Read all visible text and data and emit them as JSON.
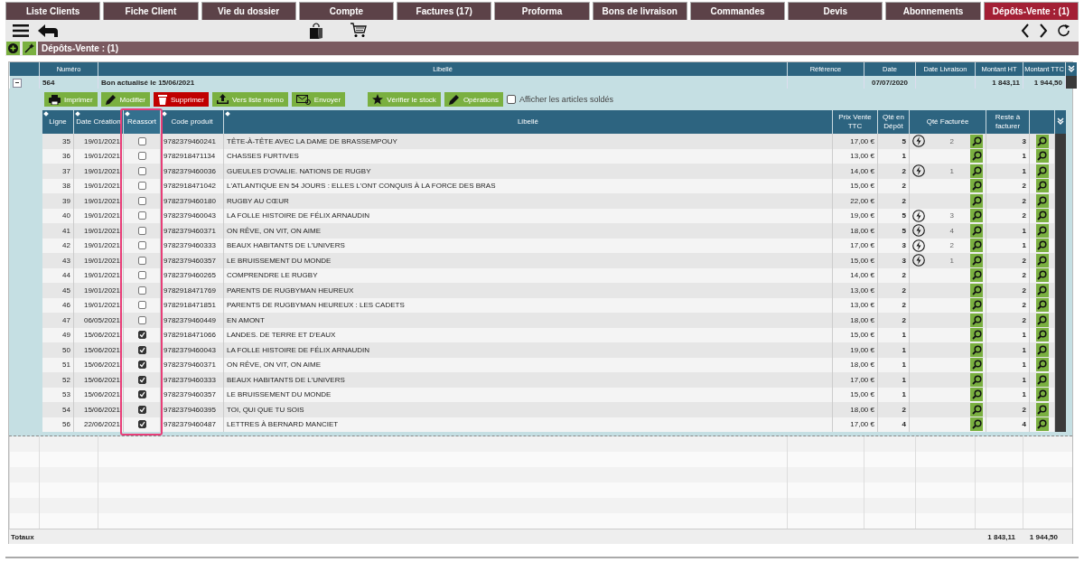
{
  "tabs": [
    {
      "label": "Liste Clients",
      "selected": false
    },
    {
      "label": "Fiche Client",
      "selected": false
    },
    {
      "label": "Vie du dossier",
      "selected": false
    },
    {
      "label": "Compte",
      "selected": false
    },
    {
      "label": "Factures (17)",
      "selected": false
    },
    {
      "label": "Proforma",
      "selected": false
    },
    {
      "label": "Bons de livraison",
      "selected": false
    },
    {
      "label": "Commandes",
      "selected": false
    },
    {
      "label": "Devis",
      "selected": false
    },
    {
      "label": "Abonnements",
      "selected": false
    },
    {
      "label": "Dépôts-Vente : (1)",
      "selected": true
    }
  ],
  "section": {
    "title": "Dépôts-Vente : (1)"
  },
  "outer_table": {
    "columns": [
      "Numéro",
      "Libellé",
      "Référence",
      "Date",
      "Date Livraison",
      "Montant HT",
      "Montant TTC"
    ],
    "row": {
      "numero": "564",
      "libelle": "Bon actualisé le 15/06/2021",
      "date": "07/07/2020",
      "montant_ht": "1 843,11",
      "montant_ttc": "1 944,50",
      "expanded": true
    }
  },
  "actions": [
    {
      "label": "Imprimer",
      "kind": "print"
    },
    {
      "label": "Modifier",
      "kind": "edit"
    },
    {
      "label": "Supprimer",
      "kind": "delete"
    },
    {
      "label": "Vers liste mémo",
      "kind": "upload"
    },
    {
      "label": "Envoyer",
      "kind": "mail"
    },
    {
      "label": "Vérifier le stock",
      "kind": "star"
    },
    {
      "label": "Opérations",
      "kind": "edit"
    }
  ],
  "show_sold": {
    "label": "Afficher les articles soldés",
    "checked": false
  },
  "lines_table": {
    "columns": [
      {
        "label": "Ligne",
        "sortable": true,
        "highlighted": false
      },
      {
        "label": "Date Création",
        "sortable": true,
        "highlighted": false
      },
      {
        "label": "Réassort",
        "sortable": true,
        "highlighted": true
      },
      {
        "label": "Code produit",
        "sortable": true,
        "highlighted": false
      },
      {
        "label": "Libellé",
        "sortable": true,
        "highlighted": false
      },
      {
        "label": "Prix Vente TTC",
        "sortable": false,
        "highlighted": false
      },
      {
        "label": "Qté en Dépôt",
        "sortable": false,
        "highlighted": false
      },
      {
        "label": "Qté Facturée",
        "sortable": false,
        "highlighted": false
      },
      {
        "label": "Reste à facturer",
        "sortable": false,
        "highlighted": false
      }
    ],
    "rows": [
      {
        "ligne": "35",
        "date": "19/01/2021",
        "reassort": false,
        "code": "9782379460241",
        "libelle": "TÊTE-À-TÊTE AVEC LA DAME DE BRASSEMPOUY",
        "prix": "17,00 €",
        "depot": "5",
        "facturee": "2",
        "reste": "3"
      },
      {
        "ligne": "36",
        "date": "19/01/2021",
        "reassort": false,
        "code": "9782918471134",
        "libelle": "CHASSES FURTIVES",
        "prix": "13,00 €",
        "depot": "1",
        "reste": "1"
      },
      {
        "ligne": "37",
        "date": "19/01/2021",
        "reassort": false,
        "code": "9782379460036",
        "libelle": "GUEULES D'OVALIE. NATIONS DE RUGBY",
        "prix": "14,00 €",
        "depot": "2",
        "facturee": "1",
        "reste": "1"
      },
      {
        "ligne": "38",
        "date": "19/01/2021",
        "reassort": false,
        "code": "9782918471042",
        "libelle": "L'ATLANTIQUE EN 54 JOURS : ELLES L'ONT CONQUIS À LA FORCE DES BRAS",
        "prix": "15,00 €",
        "depot": "2",
        "reste": "2"
      },
      {
        "ligne": "39",
        "date": "19/01/2021",
        "reassort": false,
        "code": "9782379460180",
        "libelle": "RUGBY AU CŒUR",
        "prix": "22,00 €",
        "depot": "2",
        "reste": "2"
      },
      {
        "ligne": "40",
        "date": "19/01/2021",
        "reassort": false,
        "code": "9782379460043",
        "libelle": "LA FOLLE HISTOIRE DE FÉLIX ARNAUDIN",
        "prix": "19,00 €",
        "depot": "5",
        "facturee": "3",
        "reste": "2"
      },
      {
        "ligne": "41",
        "date": "19/01/2021",
        "reassort": false,
        "code": "9782379460371",
        "libelle": "ON RÊVE, ON VIT, ON AIME",
        "prix": "18,00 €",
        "depot": "5",
        "facturee": "4",
        "reste": "1"
      },
      {
        "ligne": "42",
        "date": "19/01/2021",
        "reassort": false,
        "code": "9782379460333",
        "libelle": "BEAUX HABITANTS DE L'UNIVERS",
        "prix": "17,00 €",
        "depot": "3",
        "facturee": "2",
        "reste": "1"
      },
      {
        "ligne": "43",
        "date": "19/01/2021",
        "reassort": false,
        "code": "9782379460357",
        "libelle": "LE BRUISSEMENT DU MONDE",
        "prix": "15,00 €",
        "depot": "3",
        "facturee": "1",
        "reste": "2"
      },
      {
        "ligne": "44",
        "date": "19/01/2021",
        "reassort": false,
        "code": "9782379460265",
        "libelle": "COMPRENDRE LE RUGBY",
        "prix": "14,00 €",
        "depot": "2",
        "reste": "2"
      },
      {
        "ligne": "45",
        "date": "19/01/2021",
        "reassort": false,
        "code": "9782918471769",
        "libelle": "PARENTS DE RUGBYMAN HEUREUX",
        "prix": "13,00 €",
        "depot": "2",
        "reste": "2"
      },
      {
        "ligne": "46",
        "date": "19/01/2021",
        "reassort": false,
        "code": "9782918471851",
        "libelle": "PARENTS DE RUGBYMAN HEUREUX : LES CADETS",
        "prix": "13,00 €",
        "depot": "2",
        "reste": "2"
      },
      {
        "ligne": "47",
        "date": "06/05/2021",
        "reassort": false,
        "code": "9782379460449",
        "libelle": "EN AMONT",
        "prix": "18,00 €",
        "depot": "2",
        "reste": "2"
      },
      {
        "ligne": "49",
        "date": "15/06/2021",
        "reassort": true,
        "code": "9782918471066",
        "libelle": "LANDES. DE TERRE ET D'EAUX",
        "prix": "15,00 €",
        "depot": "1",
        "reste": "1"
      },
      {
        "ligne": "50",
        "date": "15/06/2021",
        "reassort": true,
        "code": "9782379460043",
        "libelle": "LA FOLLE HISTOIRE DE FÉLIX ARNAUDIN",
        "prix": "19,00 €",
        "depot": "1",
        "reste": "1"
      },
      {
        "ligne": "51",
        "date": "15/06/2021",
        "reassort": true,
        "code": "9782379460371",
        "libelle": "ON RÊVE, ON VIT, ON AIME",
        "prix": "18,00 €",
        "depot": "1",
        "reste": "1"
      },
      {
        "ligne": "52",
        "date": "15/06/2021",
        "reassort": true,
        "code": "9782379460333",
        "libelle": "BEAUX HABITANTS DE L'UNIVERS",
        "prix": "17,00 €",
        "depot": "1",
        "reste": "1"
      },
      {
        "ligne": "53",
        "date": "15/06/2021",
        "reassort": true,
        "code": "9782379460357",
        "libelle": "LE BRUISSEMENT DU MONDE",
        "prix": "15,00 €",
        "depot": "1",
        "reste": "1"
      },
      {
        "ligne": "54",
        "date": "15/06/2021",
        "reassort": true,
        "code": "9782379460395",
        "libelle": "TOI, QUI QUE TU SOIS",
        "prix": "18,00 €",
        "depot": "2",
        "reste": "2"
      },
      {
        "ligne": "56",
        "date": "22/06/2021",
        "reassort": true,
        "code": "9782379460487",
        "libelle": "LETTRES À BERNARD MANCIET",
        "prix": "17,00 €",
        "depot": "4",
        "reste": "4"
      }
    ]
  },
  "totals": {
    "label": "Totaux",
    "montant_ht": "1 843,11",
    "montant_ttc": "1 944,50"
  }
}
